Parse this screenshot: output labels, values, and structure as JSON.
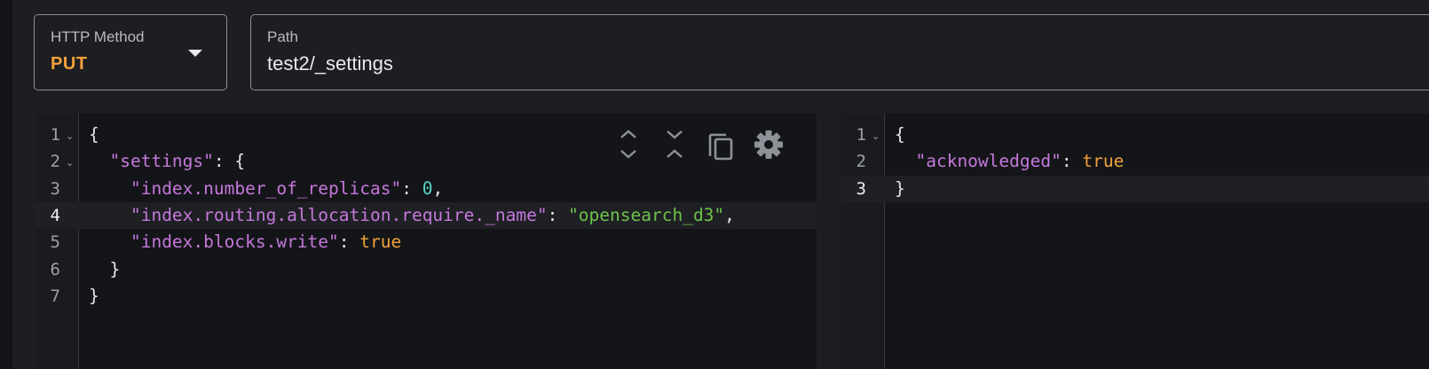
{
  "method_field": {
    "label": "HTTP Method",
    "value": "PUT",
    "accent": "#f5a13c"
  },
  "path_field": {
    "label": "Path",
    "value": "test2/_settings"
  },
  "request_editor": {
    "lines": [
      {
        "num": "1",
        "fold": true,
        "tokens": [
          {
            "t": "p",
            "v": "{"
          }
        ]
      },
      {
        "num": "2",
        "fold": true,
        "tokens": [
          {
            "t": "p",
            "v": "  "
          },
          {
            "t": "k",
            "v": "\"settings\""
          },
          {
            "t": "p",
            "v": ": {"
          }
        ]
      },
      {
        "num": "3",
        "fold": false,
        "tokens": [
          {
            "t": "p",
            "v": "    "
          },
          {
            "t": "k",
            "v": "\"index.number_of_replicas\""
          },
          {
            "t": "p",
            "v": ": "
          },
          {
            "t": "n",
            "v": "0"
          },
          {
            "t": "p",
            "v": ","
          }
        ]
      },
      {
        "num": "4",
        "fold": false,
        "active": true,
        "tokens": [
          {
            "t": "p",
            "v": "    "
          },
          {
            "t": "k",
            "v": "\"index.routing.allocation.require._name\""
          },
          {
            "t": "p",
            "v": ": "
          },
          {
            "t": "s",
            "v": "\"opensearch_d3\""
          },
          {
            "t": "p",
            "v": ","
          }
        ]
      },
      {
        "num": "5",
        "fold": false,
        "tokens": [
          {
            "t": "p",
            "v": "    "
          },
          {
            "t": "k",
            "v": "\"index.blocks.write\""
          },
          {
            "t": "p",
            "v": ": "
          },
          {
            "t": "b",
            "v": "true"
          }
        ]
      },
      {
        "num": "6",
        "fold": false,
        "tokens": [
          {
            "t": "p",
            "v": "  }"
          }
        ]
      },
      {
        "num": "7",
        "fold": false,
        "tokens": [
          {
            "t": "p",
            "v": "}"
          }
        ]
      }
    ],
    "toolbar": [
      "expand-all-icon",
      "collapse-all-icon",
      "copy-icon",
      "gear-icon"
    ]
  },
  "response_editor": {
    "lines": [
      {
        "num": "1",
        "fold": true,
        "tokens": [
          {
            "t": "p",
            "v": "{"
          }
        ]
      },
      {
        "num": "2",
        "fold": false,
        "tokens": [
          {
            "t": "p",
            "v": "  "
          },
          {
            "t": "k",
            "v": "\"acknowledged\""
          },
          {
            "t": "p",
            "v": ": "
          },
          {
            "t": "b",
            "v": "true"
          }
        ]
      },
      {
        "num": "3",
        "fold": false,
        "active": true,
        "tokens": [
          {
            "t": "p",
            "v": "}"
          }
        ]
      }
    ]
  },
  "colors": {
    "key": "#c678dd",
    "number": "#56d4c4",
    "string": "#6cc24a",
    "boolean": "#f0a23b",
    "background": "#1d1e22",
    "editor_bg": "#141518"
  }
}
